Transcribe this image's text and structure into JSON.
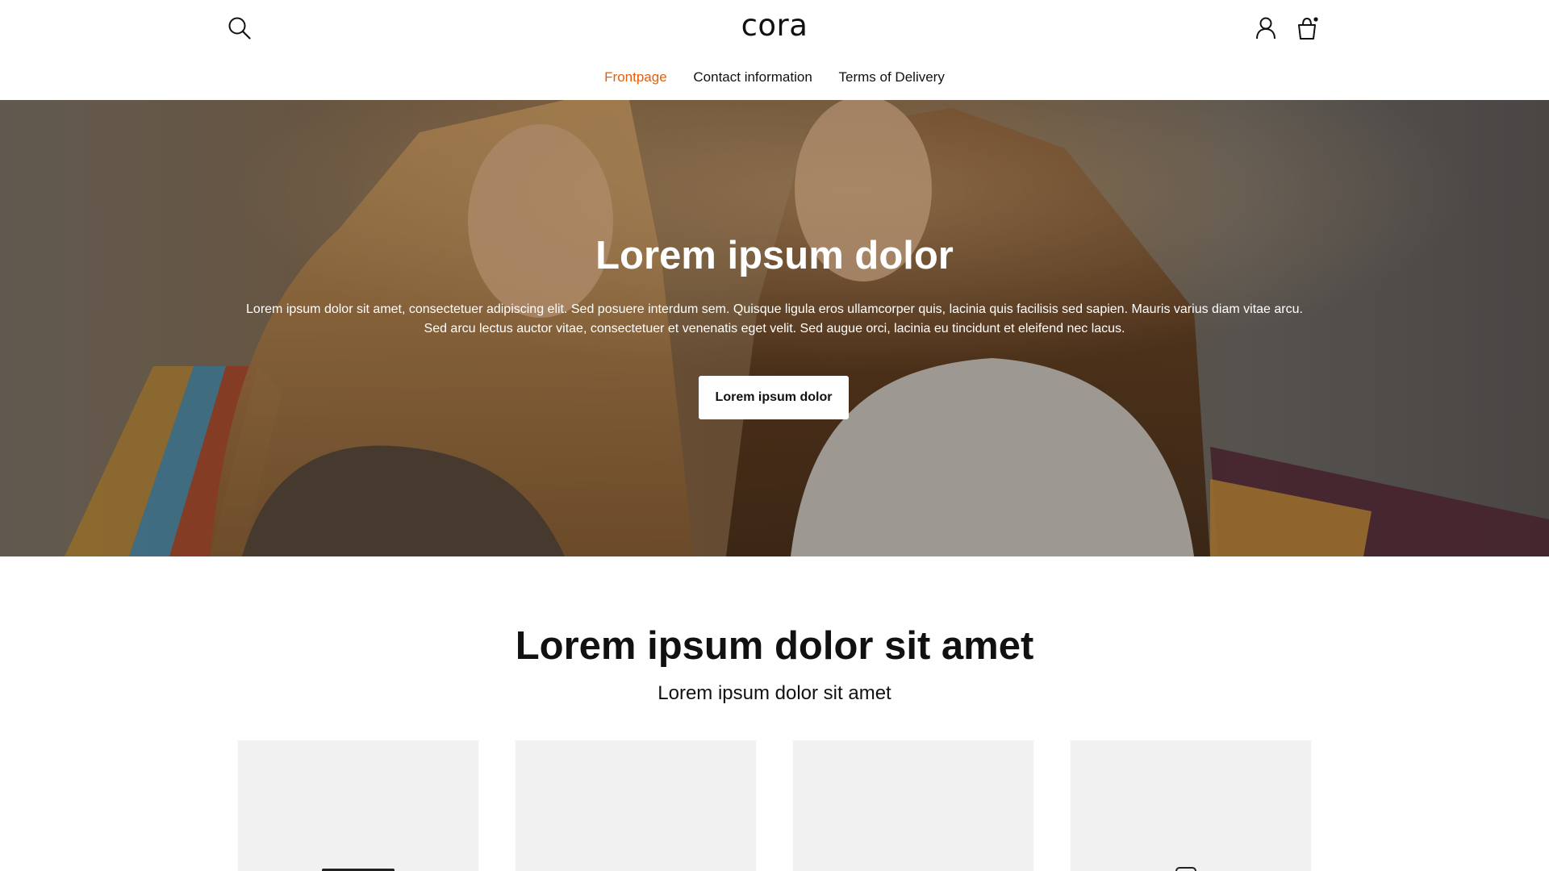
{
  "header": {
    "logo": "cora",
    "icons": {
      "search": "search-icon",
      "account": "user-icon",
      "cart": "shopping-bag-icon"
    },
    "nav": [
      {
        "label": "Frontpage",
        "active": true
      },
      {
        "label": "Contact information",
        "active": false
      },
      {
        "label": "Terms of Delivery",
        "active": false
      }
    ]
  },
  "hero": {
    "title": "Lorem ipsum dolor",
    "text": "Lorem ipsum dolor sit amet, consectetuer adipiscing elit. Sed posuere interdum sem. Quisque ligula eros ullamcorper quis, lacinia quis facilisis sed sapien. Mauris varius diam vitae arcu. Sed arcu lectus auctor vitae, consectetuer et venenatis eget velit. Sed augue orci, lacinia eu tincidunt et eleifend nec lacus.",
    "button_label": "Lorem ipsum dolor"
  },
  "section": {
    "title": "Lorem ipsum dolor sit amet",
    "subtitle": "Lorem ipsum dolor sit amet"
  },
  "colors": {
    "accent": "#e0600f",
    "card_background": "#f1f1f1",
    "text": "#111111"
  }
}
